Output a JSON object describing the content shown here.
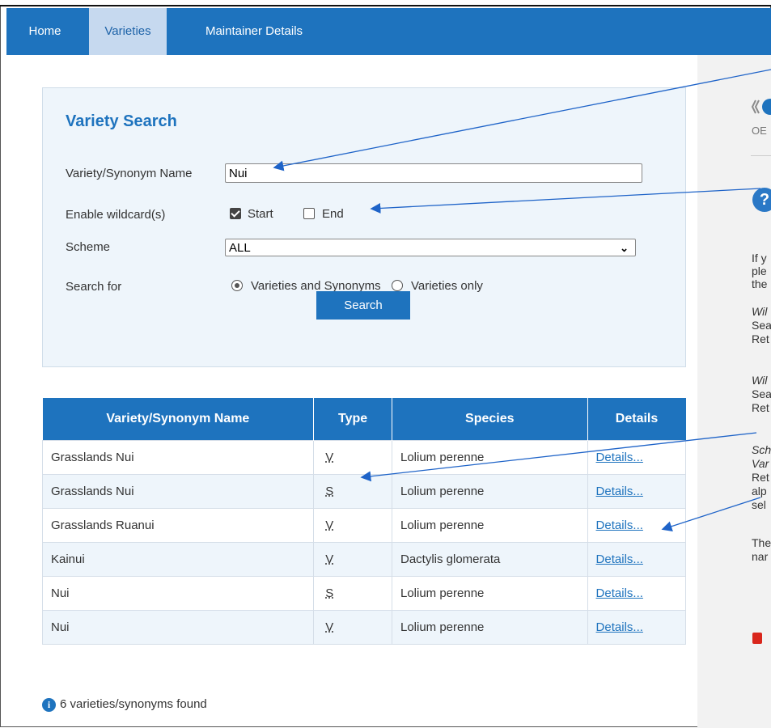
{
  "nav": {
    "items": [
      {
        "label": "Home"
      },
      {
        "label": "Varieties"
      },
      {
        "label": "Maintainer Details"
      }
    ]
  },
  "search": {
    "title": "Variety Search",
    "name_label": "Variety/Synonym Name",
    "name_value": "Nui",
    "wildcard_label": "Enable wildcard(s)",
    "wildcard_start": "Start",
    "wildcard_end": "End",
    "scheme_label": "Scheme",
    "scheme_value": "ALL",
    "searchfor_label": "Search for",
    "opt_varieties_synonyms": "Varieties and Synonyms",
    "opt_varieties_only": "Varieties only",
    "button": "Search"
  },
  "results": {
    "headers": [
      "Variety/Synonym Name",
      "Type",
      "Species",
      "Details"
    ],
    "rows": [
      {
        "name": "Grasslands Nui",
        "type": "V",
        "species": "Lolium perenne",
        "details": "Details..."
      },
      {
        "name": "Grasslands Nui",
        "type": "S",
        "species": "Lolium perenne",
        "details": "Details..."
      },
      {
        "name": "Grasslands Ruanui",
        "type": "V",
        "species": "Lolium perenne",
        "details": "Details..."
      },
      {
        "name": "Kainui",
        "type": "V",
        "species": "Dactylis glomerata",
        "details": "Details..."
      },
      {
        "name": "Nui",
        "type": "S",
        "species": "Lolium perenne",
        "details": "Details..."
      },
      {
        "name": "Nui",
        "type": "V",
        "species": "Lolium perenne",
        "details": "Details..."
      }
    ],
    "found_text": "6 varieties/synonyms found"
  },
  "sidebar": {
    "logo_text": "OE",
    "help_icon": "?",
    "lines": [
      "If y",
      "ple",
      "the",
      "Wil",
      "Sea",
      "Ret",
      "Wil",
      "Sea",
      "Ret",
      "Sch",
      "Var",
      "Ret",
      "alp",
      "sel",
      "The",
      "nar"
    ]
  },
  "colors": {
    "accent": "#1e73be",
    "panel_bg": "#eef5fb",
    "active_tab_bg": "#c6d9ef"
  }
}
